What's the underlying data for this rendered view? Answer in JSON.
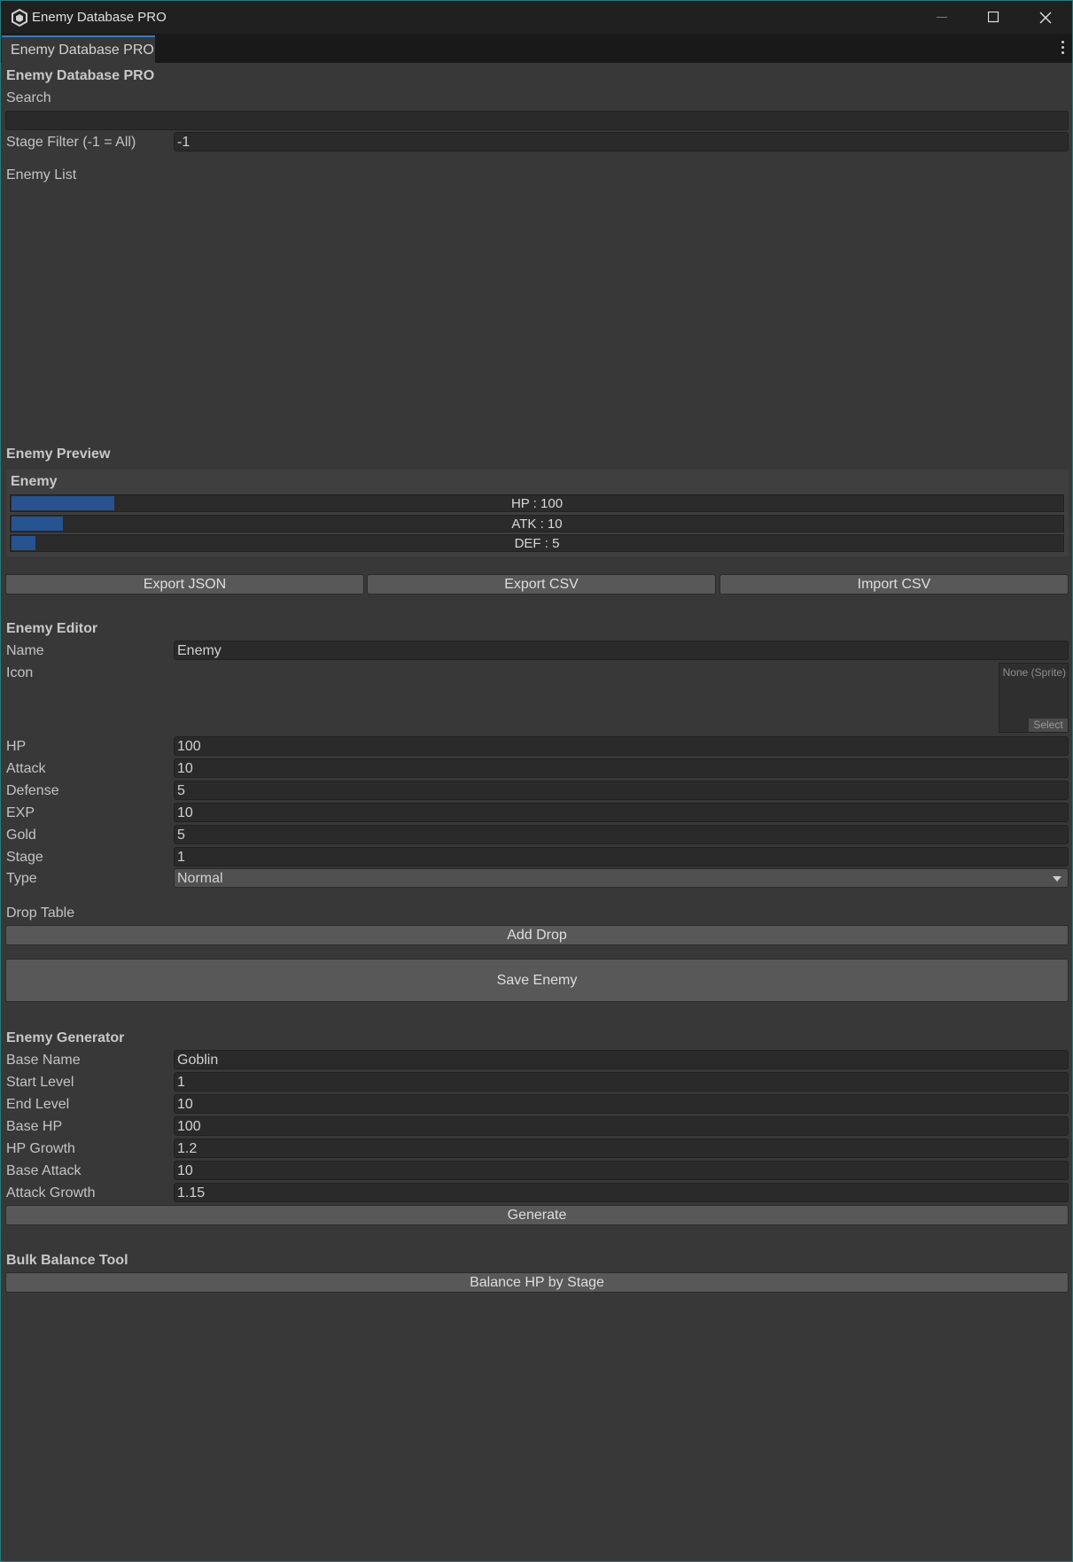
{
  "window": {
    "title": "Enemy Database PRO",
    "tab_label": "Enemy Database PRO"
  },
  "panel": {
    "header": "Enemy Database PRO",
    "search_label": "Search",
    "search_value": "",
    "stage_filter_label": "Stage Filter (-1 = All)",
    "stage_filter_value": "-1",
    "enemy_list_label": "Enemy List"
  },
  "preview": {
    "header": "Enemy Preview",
    "enemy_name": "Enemy",
    "stats": [
      {
        "label": "HP : 100",
        "fraction": 0.098
      },
      {
        "label": "ATK : 10",
        "fraction": 0.049
      },
      {
        "label": "DEF : 5",
        "fraction": 0.023
      }
    ]
  },
  "io_buttons": {
    "export_json": "Export JSON",
    "export_csv": "Export CSV",
    "import_csv": "Import CSV"
  },
  "editor": {
    "header": "Enemy Editor",
    "name_label": "Name",
    "name_value": "Enemy",
    "icon_label": "Icon",
    "icon_none": "None (Sprite)",
    "icon_select": "Select",
    "hp_label": "HP",
    "hp_value": "100",
    "attack_label": "Attack",
    "attack_value": "10",
    "defense_label": "Defense",
    "defense_value": "5",
    "exp_label": "EXP",
    "exp_value": "10",
    "gold_label": "Gold",
    "gold_value": "5",
    "stage_label": "Stage",
    "stage_value": "1",
    "type_label": "Type",
    "type_value": "Normal",
    "drop_table_label": "Drop Table",
    "add_drop": "Add Drop",
    "save_enemy": "Save Enemy"
  },
  "generator": {
    "header": "Enemy Generator",
    "base_name_label": "Base Name",
    "base_name_value": "Goblin",
    "start_level_label": "Start Level",
    "start_level_value": "1",
    "end_level_label": "End Level",
    "end_level_value": "10",
    "base_hp_label": "Base HP",
    "base_hp_value": "100",
    "hp_growth_label": "HP Growth",
    "hp_growth_value": "1.2",
    "base_attack_label": "Base Attack",
    "base_attack_value": "10",
    "attack_growth_label": "Attack Growth",
    "attack_growth_value": "1.15",
    "generate": "Generate"
  },
  "bulk": {
    "header": "Bulk Balance Tool",
    "balance_hp": "Balance HP by Stage"
  }
}
